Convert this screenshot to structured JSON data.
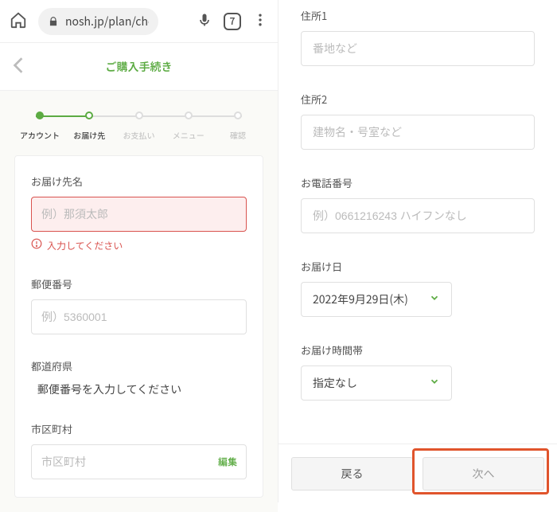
{
  "browser": {
    "url": "nosh.jp/plan/che",
    "tab_count": "7"
  },
  "page_title": "ご購入手続き",
  "steps": [
    {
      "label": "アカウント"
    },
    {
      "label": "お届け先"
    },
    {
      "label": "お支払い"
    },
    {
      "label": "メニュー"
    },
    {
      "label": "確認"
    }
  ],
  "left_form": {
    "recipient_name_label": "お届け先名",
    "recipient_name_placeholder": "例）那須太郎",
    "recipient_name_error": "入力してください",
    "postal_label": "郵便番号",
    "postal_placeholder": "例）5360001",
    "prefecture_label": "都道府県",
    "prefecture_hint": "郵便番号を入力してください",
    "city_label": "市区町村",
    "city_placeholder": "市区町村",
    "edit_label": "編集"
  },
  "right_form": {
    "address1_label": "住所1",
    "address1_placeholder": "番地など",
    "address2_label": "住所2",
    "address2_placeholder": "建物名・号室など",
    "phone_label": "お電話番号",
    "phone_placeholder": "例）0661216243 ハイフンなし",
    "delivery_date_label": "お届け日",
    "delivery_date_value": "2022年9月29日(木)",
    "delivery_time_label": "お届け時間帯",
    "delivery_time_value": "指定なし"
  },
  "footer": {
    "back": "戻る",
    "next": "次へ"
  }
}
